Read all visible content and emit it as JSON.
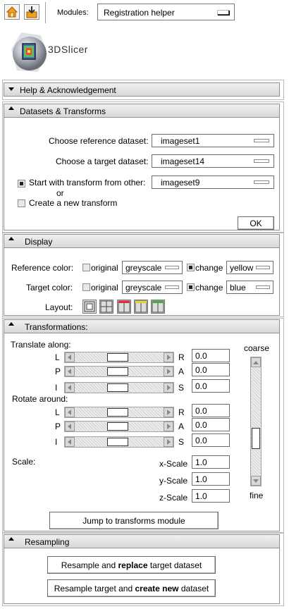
{
  "toolbar": {
    "modules_label": "Modules:",
    "module_selected": "Registration helper",
    "logo_text": "3DSlicer"
  },
  "help_section": {
    "title": "Help & Acknowledgement"
  },
  "datasets_section": {
    "title": "Datasets & Transforms",
    "ref_label": "Choose reference dataset:",
    "ref_value": "imageset1",
    "target_label": "Choose a target dataset:",
    "target_value": "imageset14",
    "start_transform_label": "Start with transform from other:",
    "start_transform_value": "imageset9",
    "start_transform_checked": true,
    "or_text": "or",
    "new_transform_label": "Create a new transform",
    "new_transform_checked": false,
    "ok_label": "OK"
  },
  "display_section": {
    "title": "Display",
    "ref_color_label": "Reference color:",
    "target_color_label": "Target color:",
    "original_label": "original",
    "change_label": "change",
    "ref_original_value": "greyscale",
    "ref_change_value": "yellow",
    "target_original_value": "greyscale",
    "target_change_value": "blue",
    "layout_label": "Layout:"
  },
  "transform_section": {
    "title": "Transformations:",
    "translate_label": "Translate along:",
    "rotate_label": "Rotate around:",
    "scale_label": "Scale:",
    "coarse_label": "coarse",
    "fine_label": "fine",
    "translate_rows": [
      {
        "left": "L",
        "right": "R",
        "value": "0.0"
      },
      {
        "left": "P",
        "right": "A",
        "value": "0.0"
      },
      {
        "left": "I",
        "right": "S",
        "value": "0.0"
      }
    ],
    "rotate_rows": [
      {
        "left": "L",
        "right": "R",
        "value": "0.0"
      },
      {
        "left": "P",
        "right": "A",
        "value": "0.0"
      },
      {
        "left": "I",
        "right": "S",
        "value": "0.0"
      }
    ],
    "scale_rows": [
      {
        "label": "x-Scale",
        "value": "1.0"
      },
      {
        "label": "y-Scale",
        "value": "1.0"
      },
      {
        "label": "z-Scale",
        "value": "1.0"
      }
    ],
    "jump_label": "Jump to transforms module"
  },
  "resampling_section": {
    "title": "Resampling",
    "replace_pre": "Resample and ",
    "replace_bold": "replace",
    "replace_post": " target dataset",
    "create_pre": "Resample target and ",
    "create_bold": "create new",
    "create_post": " dataset"
  }
}
